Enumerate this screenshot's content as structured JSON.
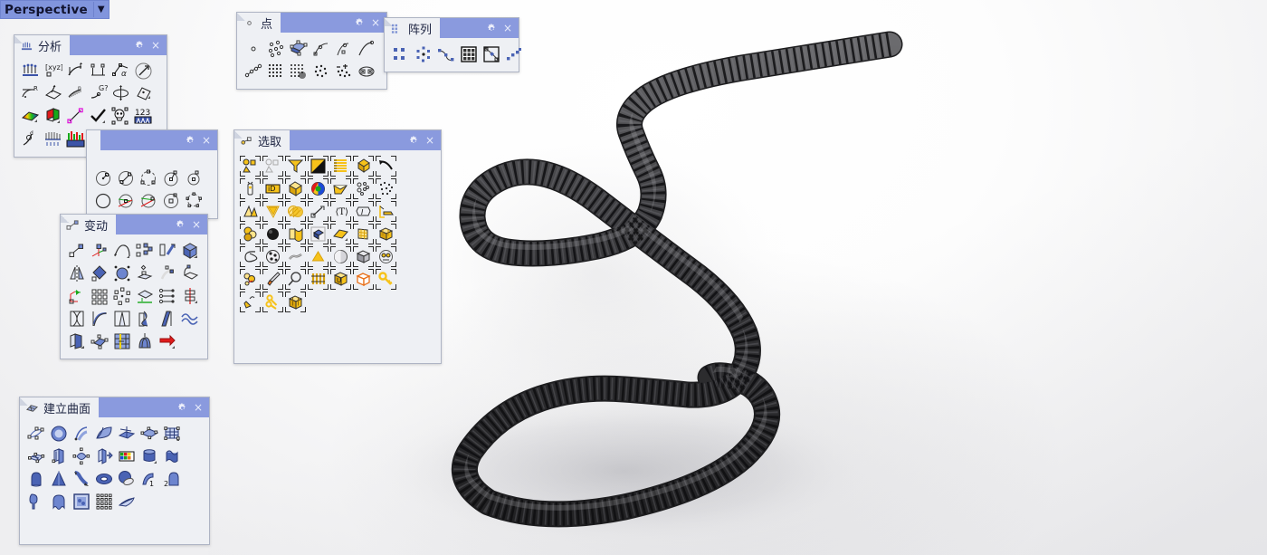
{
  "viewport": {
    "label": "Perspective",
    "dropdown_caret": "▼",
    "model": "corrugated-hose-3d-model",
    "background_color": "#f7f7f8"
  },
  "theme": {
    "titlebar_blue": "#8a9ade",
    "panel_bg": "#eef0f4",
    "panel_border": "#aeb4c4",
    "perspective_bg": "#8195dd",
    "select_icon_accent": "#f6c21a",
    "transform_icon_accent": "#4a63b4"
  },
  "common": {
    "gear_icon": "gear-icon",
    "close_icon": "×"
  },
  "toolbars": [
    {
      "id": "analysis",
      "title": "分析",
      "columns": 6,
      "icons": [
        "points-on-surface-icon",
        "xyz-coordinates-icon",
        "curve-length-icon",
        "distance-icon",
        "angle-icon",
        "direction-arrow-icon",
        "radius-icon",
        "surface-normal-icon",
        "curvature-graph-icon",
        "continuity-g-icon",
        "volume-centroid-icon",
        "area-icon",
        "curvature-analysis-icon",
        "draft-angle-icon",
        "point-deviation-icon",
        "check-mark-icon",
        "bad-objects-icon",
        "count-123-icon",
        "derivative-icon",
        "hair-comb-icon",
        "histogram-icon",
        "bounding-box-icon",
        "loupe-icon",
        "paint-bucket-icon"
      ]
    },
    {
      "id": "circle",
      "title": "",
      "columns": 5,
      "icons": [
        "circle-center-radius-icon",
        "circle-diameter-icon",
        "circle-3point-icon",
        "circle-tangent-icon",
        "circle-around-curve-icon",
        "circle-plain-icon",
        "circle-tangent-2curves-icon",
        "circle-tangent-3curves-icon",
        "circle-deformable-icon",
        "polygon-circle-icon"
      ]
    },
    {
      "id": "transform",
      "title": "变动",
      "columns": 6,
      "icons": [
        "move-icon",
        "move-uvn-icon",
        "rotate-icon",
        "copy-icon",
        "rotate-3d-icon",
        "orient-box-icon",
        "mirror-icon",
        "scale-1d-icon",
        "scale-3d-icon",
        "orient-2point-icon",
        "orient-perpendicular-icon",
        "orient-on-surface-icon",
        "remap-cplane-icon",
        "array-rectangular-icon",
        "array-polar-icon",
        "project-to-cplane-icon",
        "set-points-icon",
        "align-icon",
        "twist-icon",
        "bend-icon",
        "taper-icon",
        "shear-icon",
        "flow-along-curve-icon",
        "smooth-icon",
        "flow-icon",
        "cage-edit-icon",
        "splop-icon",
        "sporph-icon",
        "arrow-red-icon"
      ]
    },
    {
      "id": "point",
      "title": "点",
      "columns": 6,
      "icons": [
        "single-point-icon",
        "multiple-points-icon",
        "point-grid-icon",
        "point-closest-icon",
        "point-divide-icon",
        "point-curve-end-icon",
        "points-from-object-icon",
        "point-cloud-grid-icon",
        "point-cloud-dense-icon",
        "point-cloud-icon",
        "point-cloud-add-icon",
        "point-cloud-section-icon"
      ]
    },
    {
      "id": "array",
      "title": "阵列",
      "columns": 6,
      "icons": [
        "array-rect-icon",
        "array-polar-icon",
        "array-along-curve-icon",
        "array-grid-icon",
        "array-on-surface-icon",
        "array-linear-icon"
      ]
    },
    {
      "id": "select",
      "title": "选取",
      "columns": 7,
      "icons": [
        "select-objects-icon",
        "deselect-objects-icon",
        "filter-icon",
        "invert-selection-icon",
        "select-all-icon",
        "select-last-icon",
        "select-previous-icon",
        "select-next-icon",
        "select-by-id-icon",
        "select-by-layer-icon",
        "select-by-color-icon",
        "select-by-material-icon",
        "select-small-objects-icon",
        "select-points-icon",
        "select-by-name-icon",
        "select-by-wire-icon",
        "select-hatch-icon",
        "select-dimension-icon",
        "select-text-icon",
        "select-annotation-icon",
        "select-leader-icon",
        "select-group-icon",
        "select-sphere-icon",
        "select-surface-icon",
        "select-block-icon",
        "select-planar-surface-icon",
        "select-mesh-icon",
        "select-polysurface-icon",
        "select-curve-icon",
        "select-point-cloud-icon",
        "select-clipping-plane-icon",
        "select-light-icon",
        "select-sphere-object-icon",
        "select-solid-icon",
        "select-open-polysurface-icon",
        "select-extrusion-icon",
        "select-paint-icon",
        "select-magnify-icon",
        "select-hatch-lines-icon",
        "select-block-u-icon",
        "select-box-highlight-icon",
        "select-key-icon",
        "select-tag-icon",
        "select-keys-icon",
        "select-crate-icon"
      ]
    },
    {
      "id": "surface",
      "title": "建立曲面",
      "columns": 7,
      "icons": [
        "surface-control-points-icon",
        "surface-sphere-icon",
        "surface-from-curves-icon",
        "surface-edge-curves-icon",
        "surface-planar-icon",
        "surface-patch-icon",
        "surface-grid-icon",
        "surface-corner-points-icon",
        "surface-extrude-icon",
        "surface-network-icon",
        "surface-extrude-tapered-icon",
        "surface-heightfield-icon",
        "surface-revolve-icon",
        "surface-rail-revolve-icon",
        "surface-loft-icon",
        "surface-cone-icon",
        "surface-sweep1-icon",
        "surface-torus-icon",
        "surface-ellipsoid-icon",
        "surface-sweep1-rail-icon",
        "surface-sweep2-rail-icon",
        "surface-drape-icon",
        "surface-blend-icon",
        "surface-picture-frame-icon",
        "surface-point-grid-icon",
        "surface-fin-icon"
      ]
    }
  ]
}
